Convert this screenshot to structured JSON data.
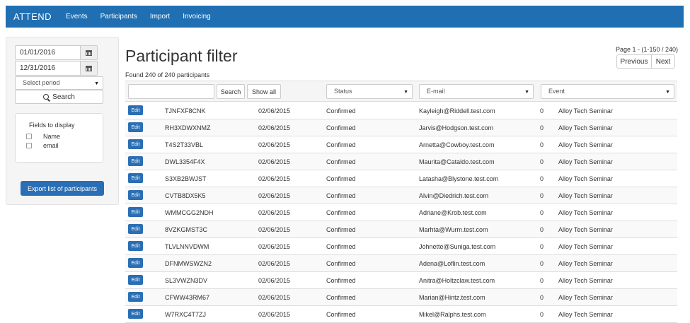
{
  "navbar": {
    "brand": "ATTEND",
    "items": [
      "Events",
      "Participants",
      "Import",
      "Invoicing"
    ]
  },
  "sidebar": {
    "date_from": "01/01/2016",
    "date_to": "12/31/2016",
    "period_placeholder": "Select period",
    "search_label": "Search",
    "fields_title": "Fields to display",
    "fields": [
      "Name",
      "email"
    ],
    "export_label": "Export list of participants"
  },
  "main": {
    "title": "Participant filter",
    "found_text": "Found 240 of 240 participants",
    "pager_info": "Page 1 - (1-150 / 240)",
    "previous_label": "Previous",
    "next_label": "Next"
  },
  "filters": {
    "search_label": "Search",
    "show_all_label": "Show all",
    "status_label": "Status",
    "email_label": "E-mail",
    "event_label": "Event"
  },
  "table": {
    "edit_label": "Edit",
    "rows": [
      {
        "code": "TJNFXF8CNK",
        "date": "02/06/2015",
        "status": "Confirmed",
        "email": "Kayleigh@Riddell.test.com",
        "num": "0",
        "event": "Alloy Tech Seminar"
      },
      {
        "code": "RH3XDWXNMZ",
        "date": "02/06/2015",
        "status": "Confirmed",
        "email": "Jarvis@Hodgson.test.com",
        "num": "0",
        "event": "Alloy Tech Seminar"
      },
      {
        "code": "T4S2T33VBL",
        "date": "02/06/2015",
        "status": "Confirmed",
        "email": "Arnetta@Cowboy.test.com",
        "num": "0",
        "event": "Alloy Tech Seminar"
      },
      {
        "code": "DWL3354F4X",
        "date": "02/06/2015",
        "status": "Confirmed",
        "email": "Maurita@Cataldo.test.com",
        "num": "0",
        "event": "Alloy Tech Seminar"
      },
      {
        "code": "S3XB2BWJST",
        "date": "02/06/2015",
        "status": "Confirmed",
        "email": "Latasha@Blystone.test.com",
        "num": "0",
        "event": "Alloy Tech Seminar"
      },
      {
        "code": "CVTB8DX5K5",
        "date": "02/06/2015",
        "status": "Confirmed",
        "email": "Alvin@Diedrich.test.com",
        "num": "0",
        "event": "Alloy Tech Seminar"
      },
      {
        "code": "WMMCGG2NDH",
        "date": "02/06/2015",
        "status": "Confirmed",
        "email": "Adriane@Krob.test.com",
        "num": "0",
        "event": "Alloy Tech Seminar"
      },
      {
        "code": "8VZKGMST3C",
        "date": "02/06/2015",
        "status": "Confirmed",
        "email": "Marhta@Wurm.test.com",
        "num": "0",
        "event": "Alloy Tech Seminar"
      },
      {
        "code": "TLVLNNVDWM",
        "date": "02/06/2015",
        "status": "Confirmed",
        "email": "Johnette@Suniga.test.com",
        "num": "0",
        "event": "Alloy Tech Seminar"
      },
      {
        "code": "DFNMWSWZN2",
        "date": "02/06/2015",
        "status": "Confirmed",
        "email": "Adena@Loflin.test.com",
        "num": "0",
        "event": "Alloy Tech Seminar"
      },
      {
        "code": "SL3VWZN3DV",
        "date": "02/06/2015",
        "status": "Confirmed",
        "email": "Anitra@Holtzclaw.test.com",
        "num": "0",
        "event": "Alloy Tech Seminar"
      },
      {
        "code": "CFWW43RM67",
        "date": "02/06/2015",
        "status": "Confirmed",
        "email": "Marian@Hintz.test.com",
        "num": "0",
        "event": "Alloy Tech Seminar"
      },
      {
        "code": "W7RXC4T7ZJ",
        "date": "02/06/2015",
        "status": "Confirmed",
        "email": "Mikel@Ralphs.test.com",
        "num": "0",
        "event": "Alloy Tech Seminar"
      }
    ]
  }
}
